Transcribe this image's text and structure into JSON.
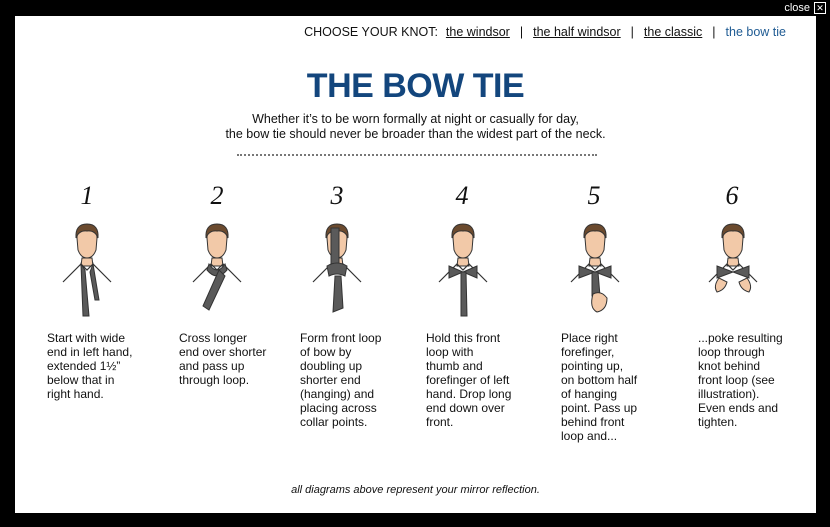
{
  "close_label": "close",
  "nav": {
    "prefix": "CHOOSE YOUR KNOT:",
    "separator": "|",
    "items": [
      {
        "label": "the windsor",
        "active": false
      },
      {
        "label": "the half windsor",
        "active": false
      },
      {
        "label": "the classic",
        "active": false
      },
      {
        "label": "the bow tie",
        "active": true
      }
    ]
  },
  "title": "THE BOW TIE",
  "subtitle": {
    "line1": "Whether it’s to be worn formally at night or casually for day,",
    "line2": "the bow tie should never be broader than the widest part of the neck."
  },
  "steps": [
    {
      "number": "1",
      "text": [
        "Start with wide",
        "end in left hand,",
        "extended 1½”",
        "below that in",
        "right hand."
      ]
    },
    {
      "number": "2",
      "text": [
        "Cross longer",
        "end over shorter",
        "and pass up",
        "through loop."
      ]
    },
    {
      "number": "3",
      "text": [
        "Form front loop",
        "of bow by",
        "doubling up",
        "shorter end",
        "(hanging) and",
        "placing across",
        "collar points."
      ]
    },
    {
      "number": "4",
      "text": [
        "Hold this front",
        "loop with",
        "thumb and",
        "forefinger of left",
        "hand. Drop long",
        "end down over",
        "front."
      ]
    },
    {
      "number": "5",
      "text": [
        "Place right",
        "forefinger,",
        "pointing up,",
        "on bottom half",
        "of hanging",
        "point. Pass up",
        "behind front",
        "loop and..."
      ]
    },
    {
      "number": "6",
      "text": [
        "...poke resulting",
        "loop through",
        "knot behind",
        "front loop (see",
        "illustration).",
        "Even ends and",
        "tighten."
      ]
    }
  ],
  "footnote": "all diagrams above represent your mirror reflection.",
  "colors": {
    "title": "#13467d",
    "active_link": "#1f5b93",
    "tie": "#5a5a5a"
  },
  "icons": {
    "close": "close-x-icon",
    "step_illustration": "man-tying-bow-tie-icon"
  }
}
